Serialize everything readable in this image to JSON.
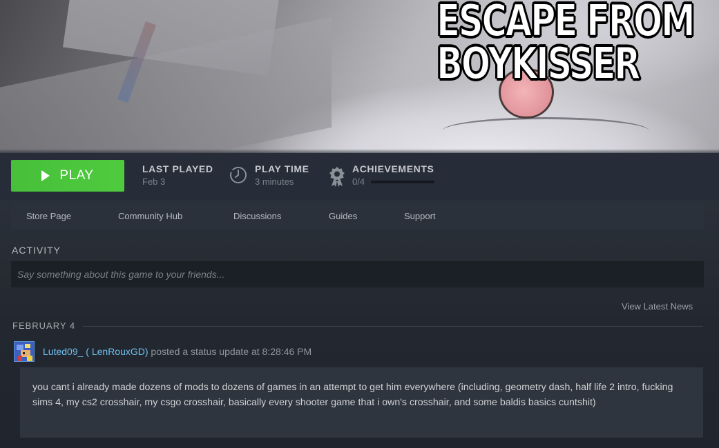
{
  "hero": {
    "title_line1": "ESCAPE FROM",
    "title_line2": "BOYKISSER"
  },
  "stats": {
    "play_label": "PLAY",
    "last_played_label": "LAST PLAYED",
    "last_played_value": "Feb 3",
    "play_time_label": "PLAY TIME",
    "play_time_value": "3 minutes",
    "achievements_label": "ACHIEVEMENTS",
    "achievements_value": "0/4",
    "achievements_progress": 0
  },
  "nav": {
    "items": [
      {
        "label": "Store Page"
      },
      {
        "label": "Community Hub"
      },
      {
        "label": "Discussions"
      },
      {
        "label": "Guides"
      },
      {
        "label": "Support"
      }
    ]
  },
  "activity": {
    "title": "ACTIVITY",
    "placeholder": "Say something about this game to your friends...",
    "view_news": "View Latest News",
    "date_header": "FEBRUARY 4",
    "post": {
      "username": "Luted09_ ( LenRouxGD)",
      "action": " posted a status update at 8:28:46 PM",
      "body": "you cant i already made dozens of mods to dozens of games in an attempt to get him everywhere (including, geometry dash, half life 2 intro, fucking sims 4, my cs2 crosshair, my csgo crosshair, basically every shooter game that i own's crosshair, and some baldis basics cuntshit)"
    }
  },
  "colors": {
    "play_green": "#4fcb3f",
    "username_blue": "#6ec0f0",
    "background": "#1e232b"
  }
}
